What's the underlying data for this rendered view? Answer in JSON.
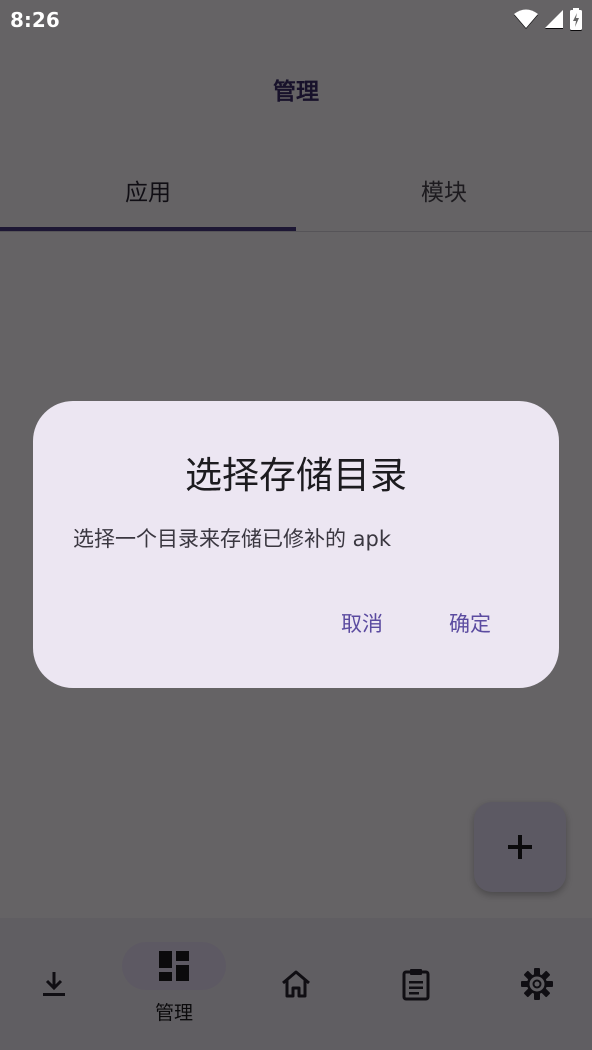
{
  "status_bar": {
    "time": "8:26"
  },
  "header": {
    "title": "管理"
  },
  "tabs": [
    {
      "label": "应用",
      "active": true
    },
    {
      "label": "模块",
      "active": false
    }
  ],
  "fab": {
    "icon": "plus-icon"
  },
  "bottom_nav": {
    "items": [
      {
        "icon": "download-icon",
        "label": "",
        "active": false
      },
      {
        "icon": "dashboard-icon",
        "label": "管理",
        "active": true
      },
      {
        "icon": "home-icon",
        "label": "",
        "active": false
      },
      {
        "icon": "clipboard-icon",
        "label": "",
        "active": false
      },
      {
        "icon": "gear-icon",
        "label": "",
        "active": false
      }
    ]
  },
  "dialog": {
    "title": "选择存储目录",
    "body": "选择一个目录来存储已修补的 apk",
    "cancel_label": "取消",
    "confirm_label": "确定"
  },
  "colors": {
    "accent": "#4a3a82",
    "dialog_bg": "#ece6f2",
    "dialog_button": "#5b4ba0",
    "nav_active_pill": "#e8def8"
  }
}
